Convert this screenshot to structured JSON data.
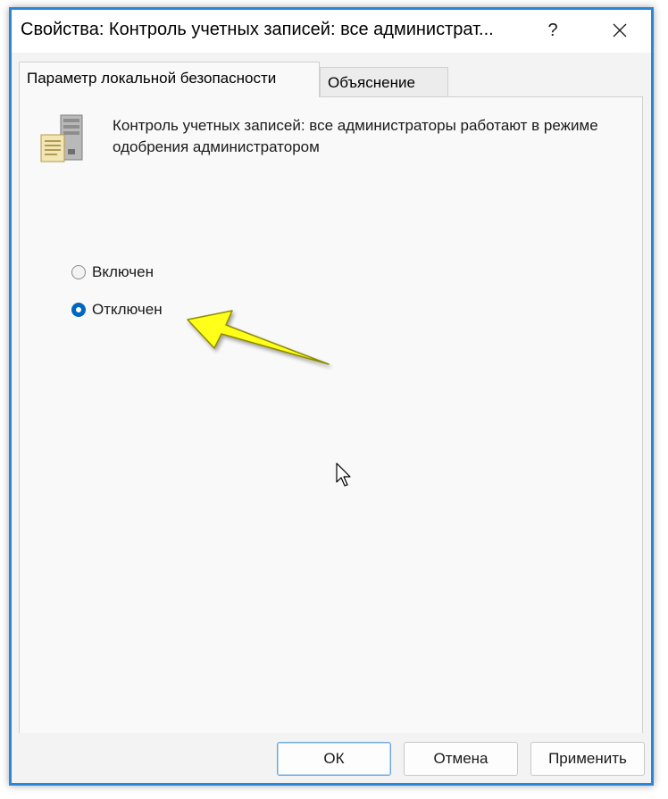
{
  "window": {
    "title": "Свойства: Контроль учетных записей: все администрат...",
    "help_label": "?",
    "close_label": "✕"
  },
  "tabs": [
    {
      "label": "Параметр локальной безопасности",
      "active": true
    },
    {
      "label": "Объяснение",
      "active": false
    }
  ],
  "policy": {
    "icon": "server-icon",
    "description": "Контроль учетных записей: все администраторы работают в режиме одобрения администратором"
  },
  "options": [
    {
      "label": "Включен",
      "checked": false
    },
    {
      "label": "Отключен",
      "checked": true
    }
  ],
  "buttons": {
    "ok": "ОК",
    "cancel": "Отмена",
    "apply": "Применить"
  },
  "colors": {
    "frame_border": "#2a86d8",
    "accent": "#0067c0",
    "arrow_fill": "#ffff1a"
  }
}
